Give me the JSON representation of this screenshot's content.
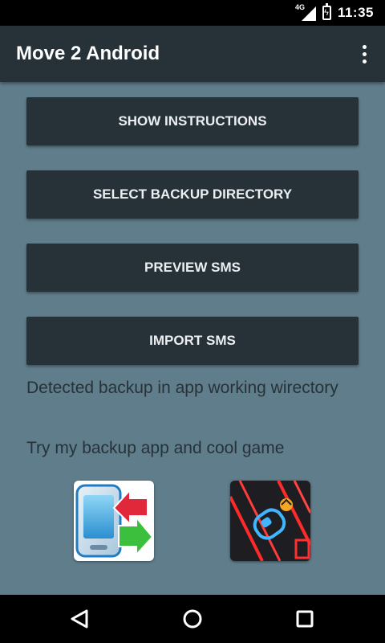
{
  "status_bar": {
    "network": "4G",
    "time": "11:35"
  },
  "app_bar": {
    "title": "Move 2 Android",
    "overflow_icon": "more-vert-icon"
  },
  "buttons": {
    "show_instructions": "SHOW INSTRUCTIONS",
    "select_backup_directory": "SELECT BACKUP DIRECTORY",
    "preview_sms": "PREVIEW SMS",
    "import_sms": "IMPORT SMS"
  },
  "status_message": "Detected backup in app working wirectory",
  "promo": {
    "text": "Try my backup app and cool game",
    "apps": [
      {
        "icon": "backup-app-icon"
      },
      {
        "icon": "game-app-icon"
      }
    ]
  },
  "nav_bar": {
    "back_icon": "back-icon",
    "home_icon": "home-icon",
    "recents_icon": "recents-icon"
  },
  "colors": {
    "background": "#607d8b",
    "app_bar": "#263238",
    "button": "#263238",
    "button_text": "#eceff1",
    "text": "#263238"
  }
}
